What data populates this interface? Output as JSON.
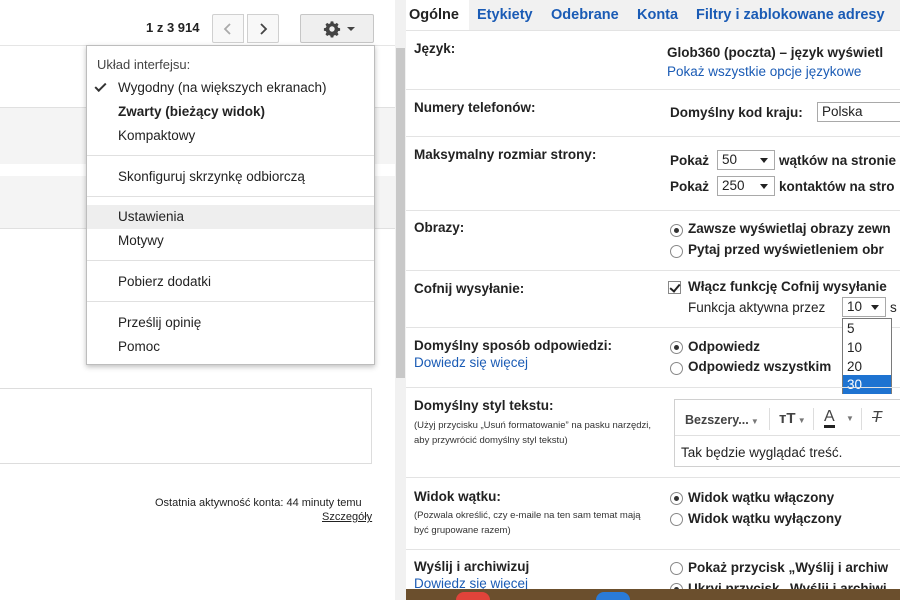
{
  "left": {
    "pager": {
      "range": "1 z 3 914",
      "prev_icon": "chevron-left-icon",
      "next_icon": "chevron-right-icon"
    },
    "settings_icon": "gear-icon",
    "menu": {
      "header": "Układ interfejsu:",
      "density": [
        {
          "label": "Wygodny (na większych ekranach)",
          "checked": true
        },
        {
          "label": "Zwarty (bieżący widok)",
          "bold": true
        },
        {
          "label": "Kompaktowy"
        }
      ],
      "configure_inbox": "Skonfiguruj skrzynkę odbiorczą",
      "settings": "Ustawienia",
      "themes": "Motywy",
      "get_addons": "Pobierz dodatki",
      "feedback": "Prześlij opinię",
      "help": "Pomoc"
    },
    "activity": "Ostatnia aktywność konta: 44 minuty temu",
    "details_link": "Szczegóły"
  },
  "right": {
    "tabs": [
      "Ogólne",
      "Etykiety",
      "Odebrane",
      "Konta",
      "Filtry i zablokowane adresy"
    ],
    "active_tab": "Ogólne",
    "language": {
      "label": "Język:",
      "value": "Glob360 (poczta) – język wyświetl",
      "link": "Pokaż wszystkie opcje językowe"
    },
    "phone": {
      "label": "Numery telefonów:",
      "country_label": "Domyślny kod kraju:",
      "country_value": "Polska"
    },
    "page_size": {
      "label": "Maksymalny rozmiar strony:",
      "show1": "Pokaż",
      "threads_value": "50",
      "threads_suffix": "wątków na stronie",
      "show2": "Pokaż",
      "contacts_value": "250",
      "contacts_suffix": "kontaktów na stro"
    },
    "images": {
      "label": "Obrazy:",
      "opt1": "Zawsze wyświetlaj obrazy zewn",
      "opt2": "Pytaj przed wyświetleniem obr"
    },
    "undo_send": {
      "label": "Cofnij wysyłanie:",
      "enable": "Włącz funkcję Cofnij wysyłanie",
      "active_for": "Funkcja aktywna przez",
      "delay_value": "10",
      "unit": "s",
      "options": [
        "5",
        "10",
        "20",
        "30"
      ],
      "highlighted_option": "30"
    },
    "reply": {
      "label": "Domyślny sposób odpowiedzi:",
      "link": "Dowiedz się więcej",
      "opt1": "Odpowiedz",
      "opt2": "Odpowiedz wszystkim"
    },
    "text_style": {
      "label": "Domyślny styl tekstu:",
      "hint": "(Użyj przycisku „Usuń formatowanie” na pasku narzędzi, aby przywrócić domyślny styl tekstu)",
      "font": "Bezszery...",
      "size_icon": "text-size-icon",
      "color_icon": "text-color-icon",
      "clear_icon": "clear-formatting-icon",
      "preview": "Tak będzie wyglądać treść."
    },
    "thread_view": {
      "label": "Widok wątku:",
      "hint": "(Pozwala określić, czy e-maile na ten sam temat mają być grupowane razem)",
      "opt1": "Widok wątku włączony",
      "opt2": "Widok wątku wyłączony"
    },
    "send_archive": {
      "label": "Wyślij i archiwizuj",
      "link": "Dowiedz się więcej",
      "opt1": "Pokaż przycisk „Wyślij i archiw",
      "opt2": "Ukryj przycisk „Wyślij i archiwi"
    }
  }
}
